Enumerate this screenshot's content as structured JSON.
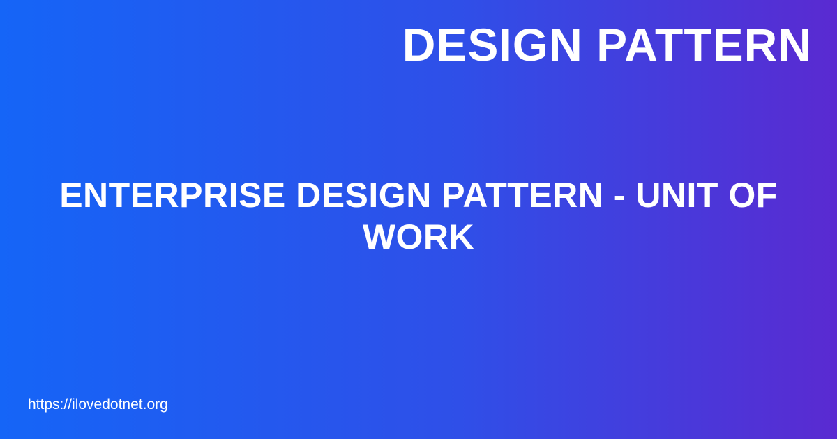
{
  "category": "DESIGN PATTERN",
  "title": "ENTERPRISE DESIGN PATTERN - UNIT OF WORK",
  "site_url": "https://ilovedotnet.org",
  "colors": {
    "gradient_start": "#1565f7",
    "gradient_mid": "#2f4fe8",
    "gradient_end": "#5a2ad1",
    "text": "#ffffff"
  }
}
